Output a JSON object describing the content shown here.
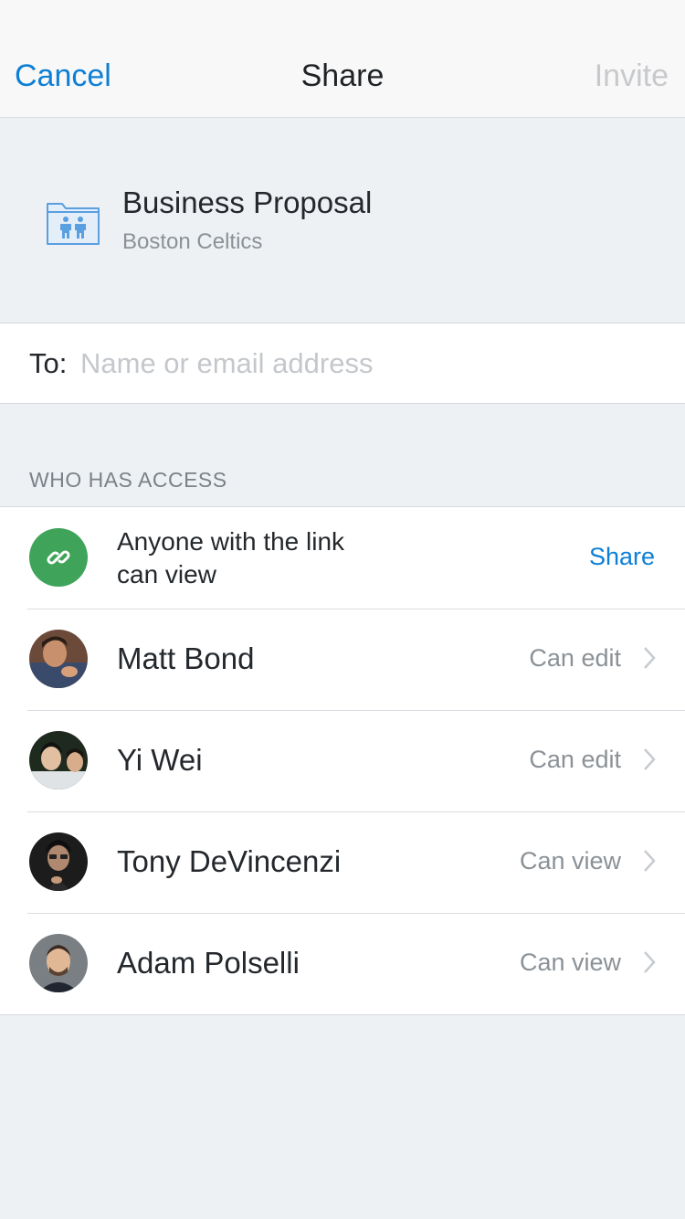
{
  "nav": {
    "cancel_label": "Cancel",
    "title": "Share",
    "invite_label": "Invite"
  },
  "folder": {
    "icon": "shared-folder-icon",
    "name": "Business Proposal",
    "subtitle": "Boston Celtics"
  },
  "to_field": {
    "label": "To:",
    "placeholder": "Name or email address",
    "value": ""
  },
  "access": {
    "section_title": "WHO HAS ACCESS",
    "link_row": {
      "icon": "link-icon",
      "text": "Anyone with the link can view",
      "action_label": "Share"
    },
    "members": [
      {
        "name": "Matt Bond",
        "permission": "Can edit"
      },
      {
        "name": "Yi Wei",
        "permission": "Can edit"
      },
      {
        "name": "Tony DeVincenzi",
        "permission": "Can view"
      },
      {
        "name": "Adam Polselli",
        "permission": "Can view"
      }
    ]
  },
  "colors": {
    "accent": "#0d7fd6",
    "link_green": "#3fa45a",
    "background": "#eef1f4"
  }
}
